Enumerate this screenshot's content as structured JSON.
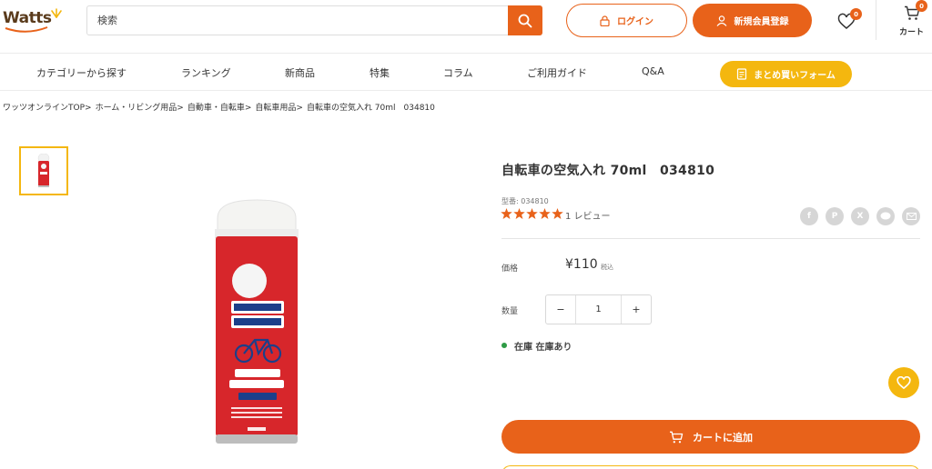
{
  "header": {
    "logo_text": "Watts",
    "search_placeholder": "検索",
    "login_label": "ログイン",
    "register_label": "新規会員登録",
    "favorites_count": "0",
    "cart_count": "0",
    "cart_label": "カート"
  },
  "nav": {
    "items": [
      "カテゴリーから探す",
      "ランキング",
      "新商品",
      "特集",
      "コラム",
      "ご利用ガイド",
      "Q&A"
    ],
    "cta_label": "まとめ買いフォーム"
  },
  "breadcrumb": [
    "ワッツオンラインTOP>",
    "ホーム・リビング用品>",
    "自動車・自転車>",
    "自転車用品>",
    "自転車の空気入れ 70ml　034810"
  ],
  "product": {
    "title": "自転車の空気入れ 70ml　034810",
    "model": "型番: 034810",
    "rating": 5,
    "review_text": "1 レビュー",
    "price_label": "価格",
    "price": "¥110",
    "tax_label": "税込",
    "qty_label": "数量",
    "qty_value": "1",
    "qty_minus": "−",
    "qty_plus": "+",
    "stock_text": "在庫 在庫あり",
    "add_to_cart_label": "カートに追加"
  },
  "share_icons": [
    "facebook-icon",
    "pinterest-icon",
    "x-icon",
    "line-icon",
    "mail-icon"
  ],
  "colors": {
    "accent_orange": "#e8621a",
    "accent_yellow": "#f4b70f",
    "stock_green": "#2e9b45"
  }
}
